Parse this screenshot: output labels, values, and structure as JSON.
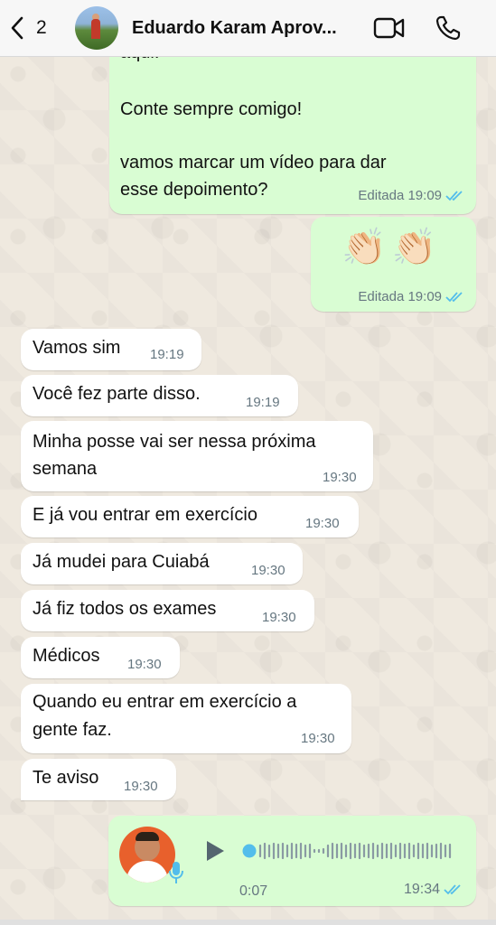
{
  "header": {
    "back_count": "2",
    "contact_name": "Eduardo Karam Aprov..."
  },
  "messages": {
    "m1": {
      "line0": "aqui.",
      "line1": "Conte sempre comigo!",
      "line2": "vamos marcar um vídeo para dar",
      "line3": "esse depoimento?",
      "meta": "Editada 19:09"
    },
    "m2": {
      "emoji": "👏🏻👏🏻",
      "meta": "Editada 19:09"
    },
    "m3": {
      "text": "Vamos sim",
      "time": "19:19"
    },
    "m4": {
      "text": "Você fez parte disso.",
      "time": "19:19"
    },
    "m5": {
      "line1": "Minha posse vai ser nessa próxima",
      "line2": "semana",
      "time": "19:30"
    },
    "m6": {
      "text": "E já vou entrar em exercício",
      "time": "19:30"
    },
    "m7": {
      "text": "Já mudei para Cuiabá",
      "time": "19:30"
    },
    "m8": {
      "text": "Já fiz todos os exames",
      "time": "19:30"
    },
    "m9": {
      "text": "Médicos",
      "time": "19:30"
    },
    "m10": {
      "line1": "Quando eu entrar em exercício a",
      "line2": "gente faz.",
      "time": "19:30"
    },
    "m11": {
      "text": "Te aviso",
      "time": "19:30"
    },
    "voice": {
      "duration": "0:07",
      "time": "19:34"
    }
  },
  "colors": {
    "outgoing": "#d9fdd3",
    "incoming": "#ffffff",
    "read_ticks": "#53bdeb",
    "header_bg": "#f7f7f7"
  },
  "icons": [
    "chevron-left-icon",
    "video-camera-icon",
    "phone-icon",
    "double-check-icon",
    "play-icon",
    "microphone-icon"
  ]
}
